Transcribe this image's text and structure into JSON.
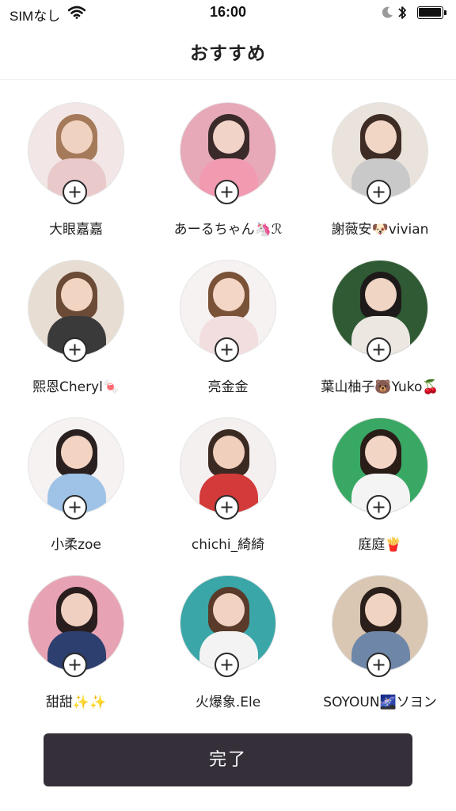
{
  "status_bar": {
    "carrier": "SIMなし",
    "time": "16:00",
    "icons": [
      "wifi-icon",
      "moon-icon",
      "bluetooth-icon",
      "battery-icon"
    ]
  },
  "header": {
    "title": "おすすめ"
  },
  "recommended_users": [
    {
      "name": "大眼嘉嘉",
      "follow_icon": "plus-icon",
      "colors": {
        "bg": "#f2e6e6",
        "hair": "#a57a5a",
        "skin": "#f0d2c0",
        "outfit": "#e9c9c9"
      }
    },
    {
      "name": "あーるちゃん🦄ℛ",
      "follow_icon": "plus-icon",
      "colors": {
        "bg": "#e7a9b8",
        "hair": "#3a2a2a",
        "skin": "#f2d3c8",
        "outfit": "#f29ab0"
      }
    },
    {
      "name": "謝薇安🐶vivian",
      "follow_icon": "plus-icon",
      "colors": {
        "bg": "#e9e3dc",
        "hair": "#3e2c24",
        "skin": "#f1d6c6",
        "outfit": "#c9c9c9"
      }
    },
    {
      "name": "熙恩Cheryl🍬",
      "follow_icon": "plus-icon",
      "colors": {
        "bg": "#e8ddd2",
        "hair": "#6b4a36",
        "skin": "#f2d4c2",
        "outfit": "#3a3a3a"
      }
    },
    {
      "name": "亮金金",
      "follow_icon": "plus-icon",
      "colors": {
        "bg": "#f7f2f2",
        "hair": "#7a5238",
        "skin": "#f3d6c6",
        "outfit": "#f2dede"
      }
    },
    {
      "name": "葉山柚子🐻Yuko🍒",
      "follow_icon": "plus-icon",
      "colors": {
        "bg": "#2f5a34",
        "hair": "#1e1a1a",
        "skin": "#f0d4c4",
        "outfit": "#ede7e2"
      }
    },
    {
      "name": "小柔zoe",
      "follow_icon": "plus-icon",
      "colors": {
        "bg": "#f6f2f2",
        "hair": "#2a2020",
        "skin": "#f3d4c2",
        "outfit": "#9fc3e6"
      }
    },
    {
      "name": "chichi_綺綺",
      "follow_icon": "plus-icon",
      "colors": {
        "bg": "#f4f0f0",
        "hair": "#3b2a22",
        "skin": "#f0cfbc",
        "outfit": "#d33a3a"
      }
    },
    {
      "name": "庭庭🍟",
      "follow_icon": "plus-icon",
      "colors": {
        "bg": "#3aa865",
        "hair": "#2a1d18",
        "skin": "#f2d5c5",
        "outfit": "#f4f4f4"
      }
    },
    {
      "name": "甜甜✨✨",
      "follow_icon": "plus-icon",
      "colors": {
        "bg": "#e7a3b4",
        "hair": "#2a1d1d",
        "skin": "#f0d0c0",
        "outfit": "#2c3f6e"
      }
    },
    {
      "name": "火爆象.Ele",
      "follow_icon": "plus-icon",
      "colors": {
        "bg": "#3aa6a8",
        "hair": "#5a3a28",
        "skin": "#f2d3c2",
        "outfit": "#f3f3f3"
      }
    },
    {
      "name": "SOYOUN🌌ソヨン",
      "follow_icon": "plus-icon",
      "colors": {
        "bg": "#d9c6b3",
        "hair": "#2a1f1a",
        "skin": "#f1d3c1",
        "outfit": "#6e87a8"
      }
    }
  ],
  "done_button": {
    "label": "完了"
  }
}
